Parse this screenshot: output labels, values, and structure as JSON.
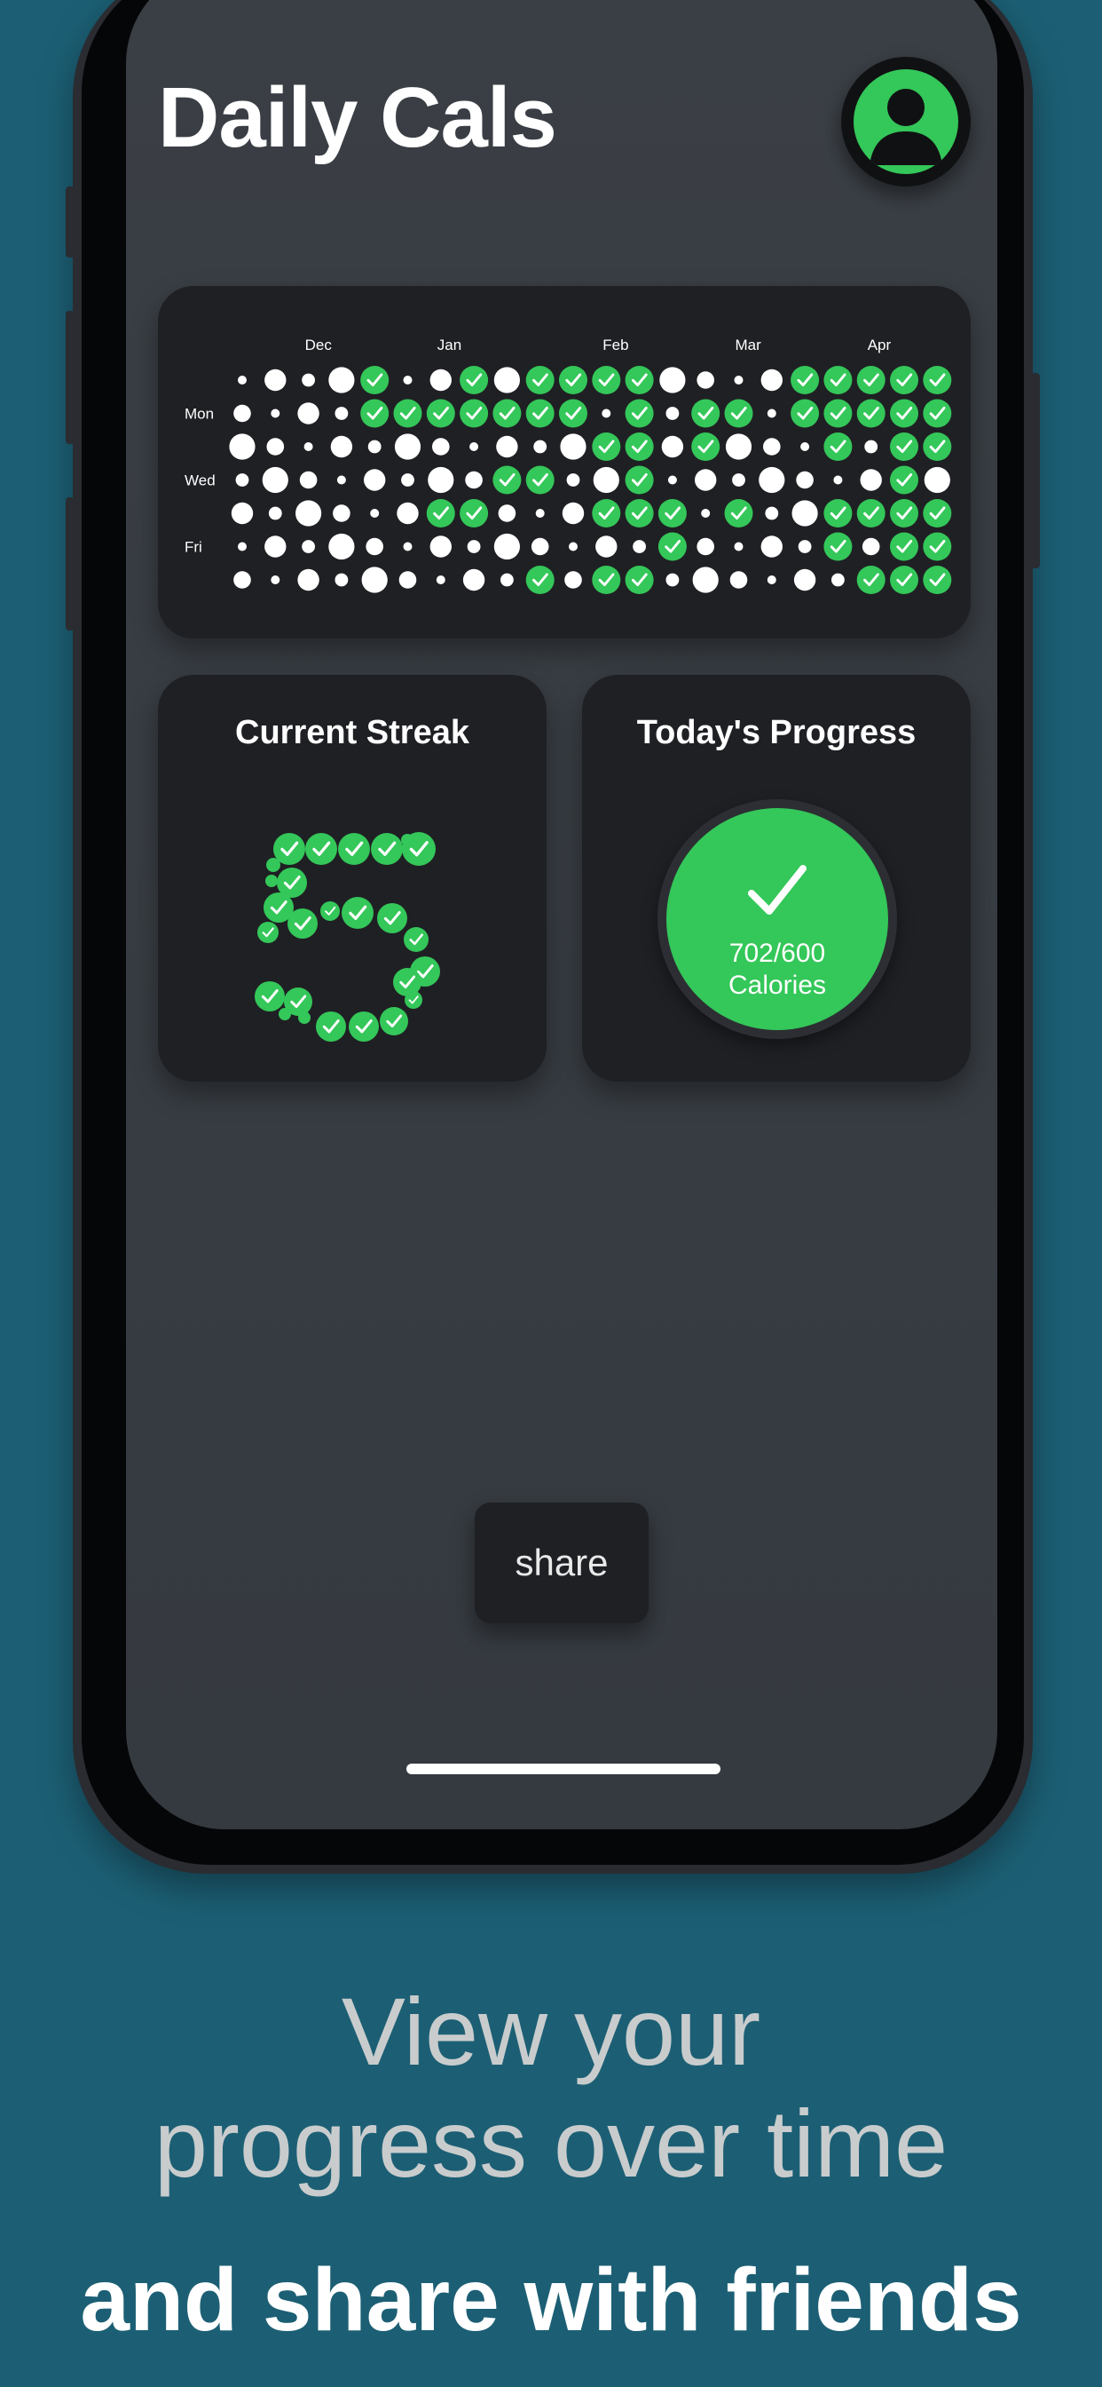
{
  "app": {
    "title": "Daily Cals"
  },
  "calendar": {
    "months": [
      "Dec",
      "Jan",
      "Feb",
      "Mar",
      "Apr"
    ],
    "day_labels": [
      "Mon",
      "Wed",
      "Fri"
    ],
    "columns": 22,
    "rows": 7,
    "completed_grid": [
      "....1..1.1111....111111",
      "....1111111.1.11.11111",
      "...........11.1...1.11",
      "........11..1.......1",
      "......11...111.1..1111",
      ".............1....1.11",
      ".........1.11......111"
    ],
    "complete_color": "#34c759",
    "incomplete_color": "#ffffff"
  },
  "streak": {
    "title": "Current Streak",
    "value": 5,
    "color": "#34c759"
  },
  "progress": {
    "title": "Today's Progress",
    "calories_text": "702/600",
    "unit_text": "Calories",
    "consumed": 702,
    "goal": 600,
    "complete": true,
    "color": "#34c759"
  },
  "share": {
    "label": "share"
  },
  "caption": {
    "line1": "View your",
    "line2": "progress over time",
    "line3": "and share with friends"
  },
  "colors": {
    "background": "#1c5f74",
    "screen": "#383d43",
    "card": "#1f2024",
    "accent": "#34c759"
  },
  "icons": {
    "avatar": "person-icon",
    "check": "checkmark-icon"
  }
}
